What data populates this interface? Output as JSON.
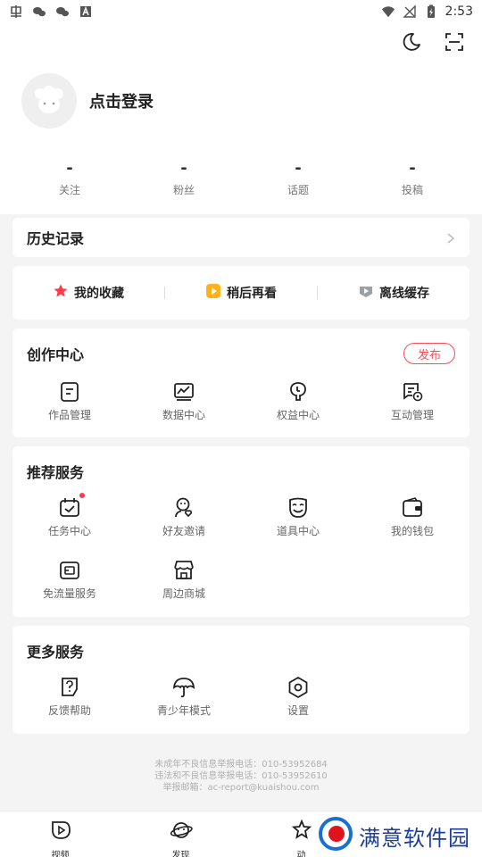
{
  "status_bar": {
    "time": "2:53",
    "left_icons": [
      "app-notification-icon",
      "wechat-icon",
      "wechat-icon",
      "a-notification-icon"
    ],
    "right_icons": [
      "wifi-icon",
      "no-signal-icon",
      "battery-charging-icon"
    ]
  },
  "top_actions": [
    "night-mode-icon",
    "scan-icon"
  ],
  "profile": {
    "login_text": "点击登录"
  },
  "stats": [
    {
      "value": "-",
      "label": "关注"
    },
    {
      "value": "-",
      "label": "粉丝"
    },
    {
      "value": "-",
      "label": "话题"
    },
    {
      "value": "-",
      "label": "投稿"
    }
  ],
  "history": {
    "title": "历史记录"
  },
  "quick_links": [
    {
      "label": "我的收藏",
      "icon": "star-icon",
      "color": "#ff3b4b"
    },
    {
      "label": "稍后再看",
      "icon": "play-later-icon",
      "color": "#ffb21b"
    },
    {
      "label": "离线缓存",
      "icon": "download-icon",
      "color": "#9aa0a6"
    }
  ],
  "creation_center": {
    "title": "创作中心",
    "publish_label": "发布",
    "items": [
      {
        "label": "作品管理",
        "icon": "works-icon"
      },
      {
        "label": "数据中心",
        "icon": "data-chart-icon"
      },
      {
        "label": "权益中心",
        "icon": "rights-icon"
      },
      {
        "label": "互动管理",
        "icon": "interaction-icon"
      }
    ]
  },
  "recommended_services": {
    "title": "推荐服务",
    "items": [
      {
        "label": "任务中心",
        "icon": "task-calendar-icon",
        "badge": true
      },
      {
        "label": "好友邀请",
        "icon": "invite-friend-icon"
      },
      {
        "label": "道具中心",
        "icon": "mask-icon"
      },
      {
        "label": "我的钱包",
        "icon": "wallet-icon"
      },
      {
        "label": "免流量服务",
        "icon": "sim-card-icon"
      },
      {
        "label": "周边商城",
        "icon": "shop-icon"
      }
    ]
  },
  "more_services": {
    "title": "更多服务",
    "items": [
      {
        "label": "反馈帮助",
        "icon": "help-feedback-icon"
      },
      {
        "label": "青少年模式",
        "icon": "umbrella-icon"
      },
      {
        "label": "设置",
        "icon": "settings-icon"
      }
    ]
  },
  "footer": {
    "line1": "未成年不良信息举报电话：010-53952684",
    "line2": "违法和不良信息举报电话：010-53952610",
    "line3": "举报邮箱：ac-report@kuaishou.com"
  },
  "bottom_nav": [
    {
      "label": "视频",
      "icon": "video-icon"
    },
    {
      "label": "发现",
      "icon": "planet-icon"
    },
    {
      "label": "动",
      "icon": "dynamic-icon"
    },
    {
      "label": "",
      "icon": ""
    }
  ],
  "watermark": {
    "text": "满意软件园"
  },
  "colors": {
    "accent": "#ff4b55",
    "background": "#f4f4f4"
  }
}
